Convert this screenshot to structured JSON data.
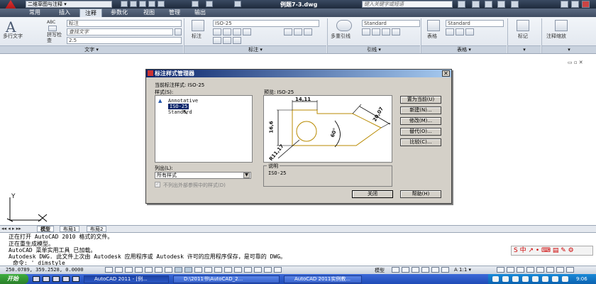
{
  "window": {
    "workspace": "二维草图与注释",
    "doc_title": "例题7-3.dwg",
    "search_placeholder": "键入关键字或短语"
  },
  "ribbon_tabs": [
    "常用",
    "插入",
    "注释",
    "参数化",
    "视图",
    "管理",
    "输出"
  ],
  "ribbon": {
    "text_panel": {
      "multiline_text": "多行文字",
      "spell_check": "拼写检查",
      "abc": "ABC",
      "style_combo": "标注",
      "find_text": "查找文字",
      "text_height": "2.5",
      "title": "文字"
    },
    "dim_panel": {
      "dim_label": "标注",
      "dim_style": "ISO-25",
      "title": "标注"
    },
    "leader_panel": {
      "mleader": "多重引线",
      "style": "Standard",
      "title": "引线"
    },
    "table_panel": {
      "table": "表格",
      "style": "Standard",
      "title": "表格"
    },
    "markup_panel": {
      "label": "标记"
    },
    "scale_panel": {
      "label": "注释缩放"
    }
  },
  "dialog": {
    "title": "标注样式管理器",
    "current_style_label": "当前标注样式: ISO-25",
    "styles_label": "样式(S):",
    "styles": [
      "Annotative",
      "ISO-25",
      "Standard"
    ],
    "selected_style": "ISO-25",
    "preview_label": "预览: ISO-25",
    "preview_dims": {
      "top": "14,11",
      "left": "16,6",
      "diag": "20,07",
      "angle": "60°",
      "radius": "R11,17"
    },
    "buttons": {
      "set_current": "置为当前(U)",
      "new": "新建(N)...",
      "modify": "修改(M)...",
      "override": "替代(O)...",
      "compare": "比较(C)..."
    },
    "list_label": "列出(L):",
    "list_value": "所有样式",
    "checkbox_label": "不列出外部参照中的样式(D)",
    "description_label": "说明",
    "description_value": "ISO-25",
    "close": "关闭",
    "help": "帮助(H)"
  },
  "layout_tabs": [
    "模型",
    "布局1",
    "布局2"
  ],
  "command_history": [
    "正在打开 AutoCAD 2010 格式的文件。",
    "正在重生成模型。",
    "AutoCAD 菜单实用工具 已加载。",
    "Autodesk DWG.   此文件上次由 Autodesk 应用程序或 Autodesk 许可的应用程序保存，是可靠的 DWG。"
  ],
  "command_prompt": "命令: '_dimstyle",
  "status": {
    "coords": "250.0789,  359.2528,  0.0000",
    "model": "模型",
    "scale": "A 1:1 ▾"
  },
  "taskbar": {
    "start": "开始",
    "tasks": [
      "AutoCAD 2011 - [例...",
      "D:\\2011书\\AutoCAD_2...",
      "AutoCAD 2011实例教..."
    ],
    "clock": "9:06"
  },
  "ime": {
    "mode": "中"
  },
  "axis": {
    "y": "Y",
    "x": "X"
  }
}
